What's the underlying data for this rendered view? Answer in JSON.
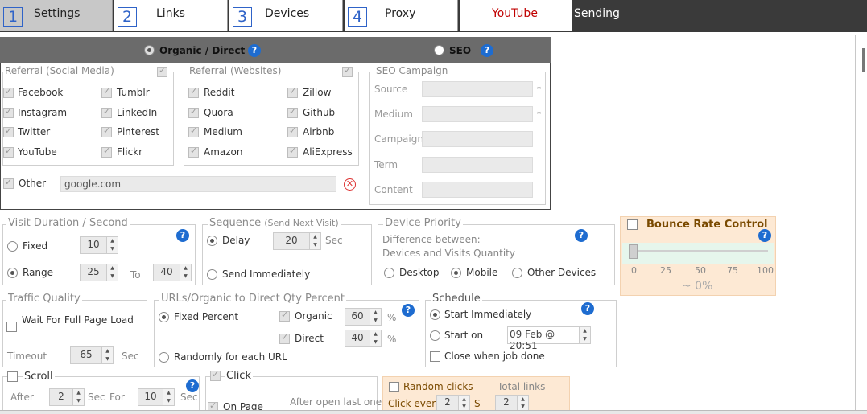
{
  "tabs": [
    {
      "num": "1",
      "label": "Settings"
    },
    {
      "num": "2",
      "label": "Links"
    },
    {
      "num": "3",
      "label": "Devices"
    },
    {
      "num": "4",
      "label": "Proxy"
    },
    {
      "label": "YouTube"
    }
  ],
  "status": "Sending",
  "modes": {
    "organic": "Organic / Direct",
    "seo": "SEO"
  },
  "social": {
    "legend": "Referral (Social Media)",
    "col1": [
      "Facebook",
      "Instagram",
      "Twitter",
      "YouTube"
    ],
    "col2": [
      "Tumblr",
      "LinkedIn",
      "Pinterest",
      "Flickr"
    ]
  },
  "websites": {
    "legend": "Referral (Websites)",
    "col1": [
      "Reddit",
      "Quora",
      "Medium",
      "Amazon"
    ],
    "col2": [
      "Zillow",
      "Github",
      "Airbnb",
      "AliExpress"
    ]
  },
  "other": {
    "label": "Other",
    "value": "google.com"
  },
  "seo": {
    "legend": "SEO Campaign",
    "fields": [
      "Source",
      "Medium",
      "Campaign",
      "Term",
      "Content"
    ],
    "required_mark": "*"
  },
  "visit": {
    "legend": "Visit Duration / Second",
    "fixed": "Fixed",
    "fixed_val": "10",
    "range": "Range",
    "range_from": "25",
    "to": "To",
    "range_to": "40"
  },
  "sequence": {
    "legend": "Sequence",
    "legend_note": "(Send Next Visit)",
    "delay": "Delay",
    "delay_val": "20",
    "sec": "Sec",
    "immediate": "Send Immediately"
  },
  "device": {
    "legend": "Device Priority",
    "line1": "Difference between:",
    "line2": "Devices and Visits Quantity",
    "options": [
      "Desktop",
      "Mobile",
      "Other Devices"
    ]
  },
  "bounce": {
    "title": "Bounce Rate Control",
    "ticks": [
      "0",
      "25",
      "50",
      "75",
      "100"
    ],
    "value": "~ 0%",
    "level": 0
  },
  "traffic": {
    "legend": "Traffic Quality",
    "wait": "Wait For Full Page Load",
    "timeout": "Timeout",
    "timeout_val": "65",
    "sec": "Sec"
  },
  "urls": {
    "legend": "URLs/Organic to Direct Qty Percent",
    "fixed": "Fixed Percent",
    "random": "Randomly for each URL",
    "organic": "Organic",
    "organic_val": "60",
    "direct": "Direct",
    "direct_val": "40",
    "pct": "%"
  },
  "schedule": {
    "legend": "Schedule",
    "start_now": "Start Immediately",
    "start_on": "Start on",
    "date": "09 Feb @ 20:51",
    "close": "Close when job done"
  },
  "scroll": {
    "label": "Scroll",
    "after": "After",
    "after_val": "2",
    "sec": "Sec",
    "for": "For",
    "for_val": "10"
  },
  "click": {
    "label": "Click",
    "on_page": "On Page",
    "after_open": "After open last one"
  },
  "random_clicks": {
    "label": "Random clicks",
    "total": "Total links",
    "every": "Click every",
    "every_val": "2",
    "s": "S",
    "total_val": "2"
  },
  "help": "?",
  "colors": {
    "topbar": "#3a3a3a",
    "youtube": "#c00000",
    "help": "#1e6cd0",
    "bounce_bg": "#fde9d4",
    "bounce_title": "#7a4a00"
  }
}
